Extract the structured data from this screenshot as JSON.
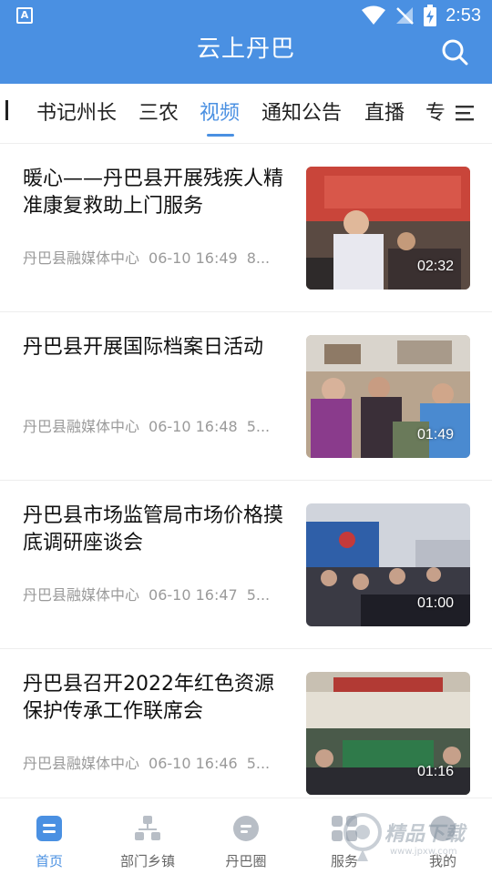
{
  "status_bar": {
    "time": "2:53",
    "left_badge": "A"
  },
  "header": {
    "title": "云上丹巴"
  },
  "tabs": [
    {
      "label": "书记州长",
      "active": false
    },
    {
      "label": "三农",
      "active": false
    },
    {
      "label": "视频",
      "active": true
    },
    {
      "label": "通知公告",
      "active": false
    },
    {
      "label": "直播",
      "active": false
    },
    {
      "label": "专",
      "active": false
    }
  ],
  "news": [
    {
      "title": "暖心——丹巴县开展残疾人精准康复救助上门服务",
      "source": "丹巴县融媒体中心",
      "time": "06-10 16:49",
      "extra": "8...",
      "duration": "02:32"
    },
    {
      "title": "丹巴县开展国际档案日活动",
      "source": "丹巴县融媒体中心",
      "time": "06-10 16:48",
      "extra": "5...",
      "duration": "01:49"
    },
    {
      "title": "丹巴县市场监管局市场价格摸底调研座谈会",
      "source": "丹巴县融媒体中心",
      "time": "06-10 16:47",
      "extra": "5...",
      "duration": "01:00"
    },
    {
      "title": "丹巴县召开2022年红色资源保护传承工作联席会",
      "source": "丹巴县融媒体中心",
      "time": "06-10 16:46",
      "extra": "5...",
      "duration": "01:16"
    }
  ],
  "bottom_nav": [
    {
      "label": "首页",
      "active": true
    },
    {
      "label": "部门乡镇",
      "active": false
    },
    {
      "label": "丹巴圈",
      "active": false
    },
    {
      "label": "服务",
      "active": false
    },
    {
      "label": "我的",
      "active": false
    }
  ],
  "watermark": {
    "text": "精品下载",
    "url": "www.jpxw.com"
  },
  "colors": {
    "accent": "#4a90e2",
    "text": "#111111",
    "meta": "#9a9a9a"
  }
}
